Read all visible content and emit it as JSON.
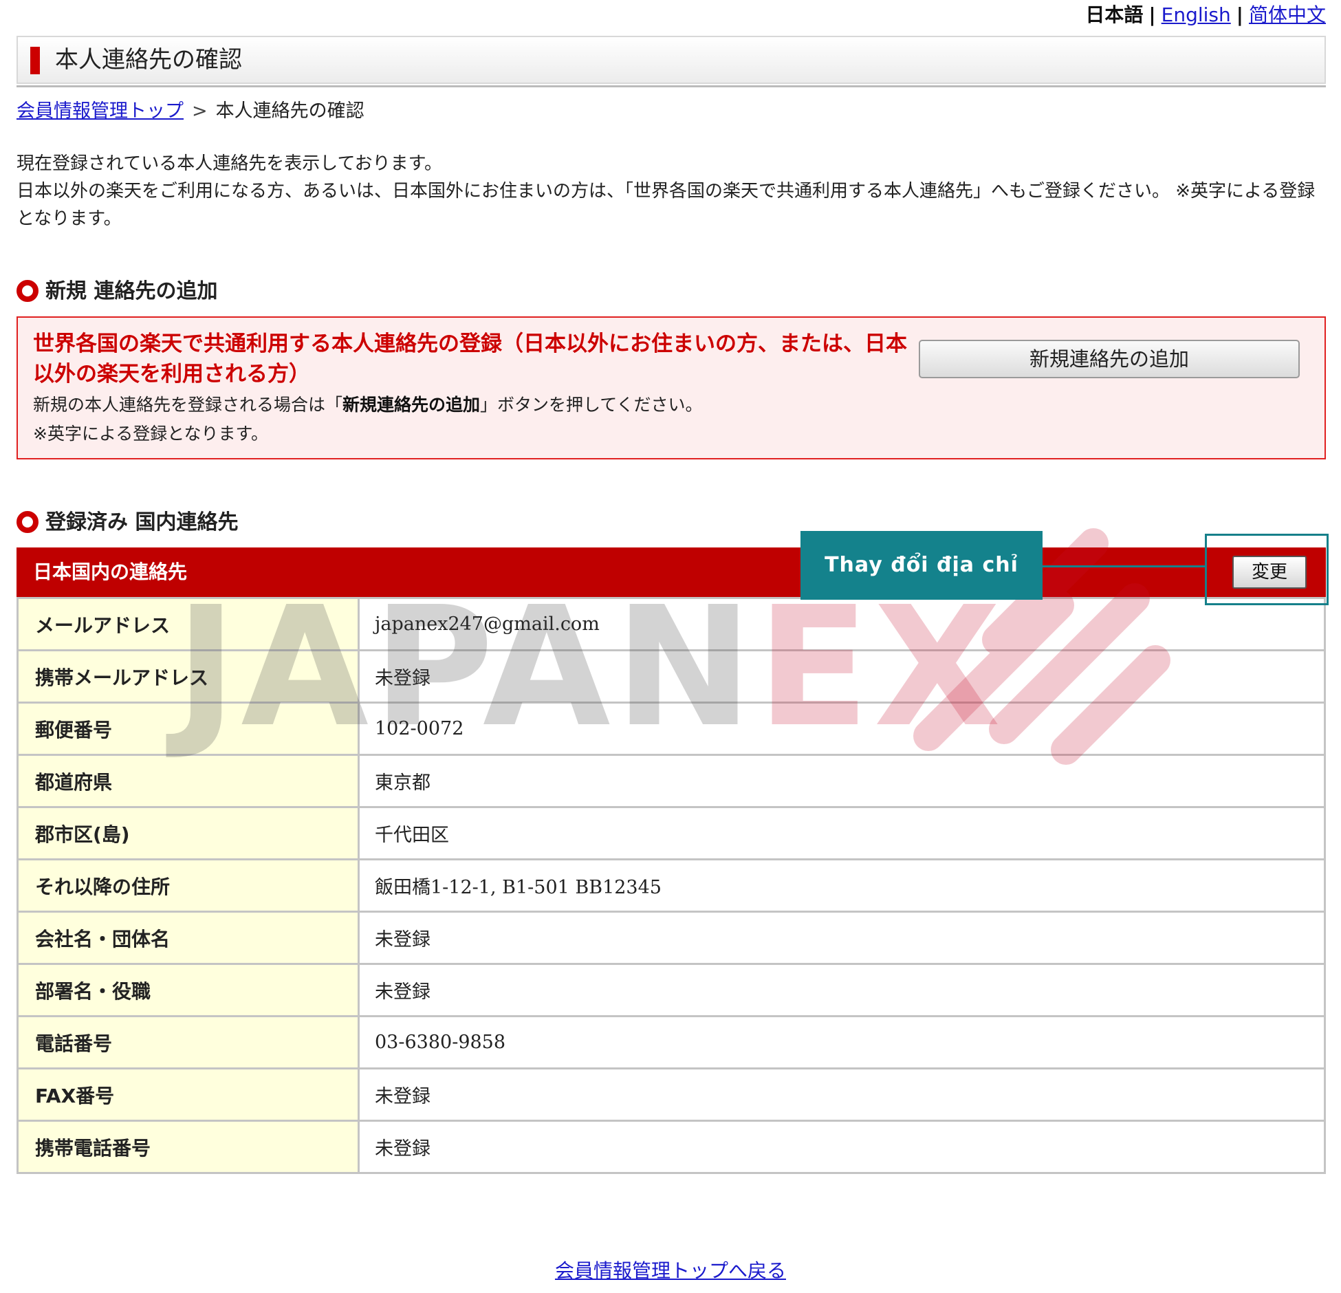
{
  "lang": {
    "current": "日本語",
    "options": [
      "English",
      "简体中文"
    ],
    "separator": "|"
  },
  "page_title": "本人連絡先の確認",
  "breadcrumb": {
    "parent": "会員情報管理トップ",
    "arrow": ">",
    "current": "本人連絡先の確認"
  },
  "intro": {
    "line1": "現在登録されている本人連絡先を表示しております。",
    "line2": "日本以外の楽天をご利用になる方、あるいは、日本国外にお住まいの方は、「世界各国の楽天で共通利用する本人連絡先」へもご登録ください。 ※英字による登録となります。"
  },
  "new_section": {
    "heading": "新規 連絡先の追加",
    "box_title": "世界各国の楽天で共通利用する本人連絡先の登録（日本以外にお住まいの方、または、日本以外の楽天を利用される方）",
    "desc_prefix": "新規の本人連絡先を登録される場合は「",
    "desc_bold": "新規連絡先の追加",
    "desc_suffix": "」ボタンを押してください。",
    "note": "※英字による登録となります。",
    "add_button": "新規連絡先の追加"
  },
  "registered_section": {
    "heading": "登録済み 国内連絡先",
    "table_title": "日本国内の連絡先",
    "change_button": "変更",
    "callout": "Thay đổi địa chỉ",
    "rows": [
      {
        "label": "メールアドレス",
        "value": "japanex247@gmail.com"
      },
      {
        "label": "携帯メールアドレス",
        "value": "未登録"
      },
      {
        "label": "郵便番号",
        "value": "102-0072"
      },
      {
        "label": "都道府県",
        "value": "東京都"
      },
      {
        "label": "郡市区(島)",
        "value": "千代田区"
      },
      {
        "label": "それ以降の住所",
        "value": "飯田橋1-12-1, B1-501 BB12345"
      },
      {
        "label": "会社名・団体名",
        "value": "未登録"
      },
      {
        "label": "部署名・役職",
        "value": "未登録"
      },
      {
        "label": "電話番号",
        "value": "03-6380-9858"
      },
      {
        "label": "FAX番号",
        "value": "未登録"
      },
      {
        "label": "携帯電話番号",
        "value": "未登録"
      }
    ]
  },
  "back_link": "会員情報管理トップへ戻る",
  "watermark": {
    "part1": "JAPAN",
    "part2": "EX"
  },
  "colors": {
    "accent_red": "#bf0000",
    "box_bg": "#fdeeee",
    "label_bg": "#ffffdd",
    "callout_teal": "#14828c",
    "link_blue": "#1a1acc"
  }
}
